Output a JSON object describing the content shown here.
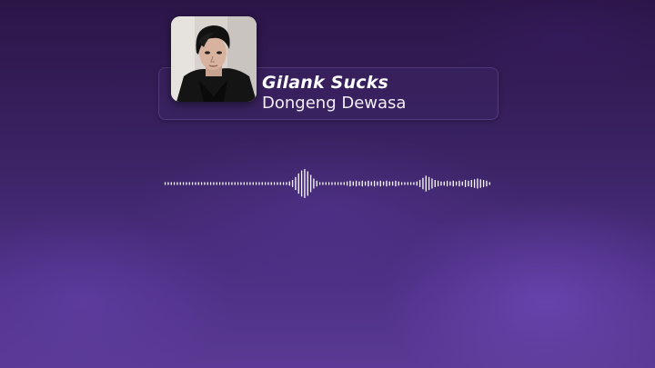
{
  "track": {
    "title": "Gilank Sucks",
    "artist": "Dongeng Dewasa",
    "cover_art": "artist-portrait-photo"
  },
  "visualizer": {
    "color": "#ffffff",
    "levels": [
      0.1,
      0.1,
      0.1,
      0.1,
      0.1,
      0.1,
      0.1,
      0.1,
      0.1,
      0.1,
      0.1,
      0.1,
      0.1,
      0.1,
      0.1,
      0.1,
      0.1,
      0.1,
      0.1,
      0.1,
      0.1,
      0.1,
      0.1,
      0.1,
      0.1,
      0.1,
      0.1,
      0.1,
      0.1,
      0.1,
      0.1,
      0.1,
      0.1,
      0.1,
      0.1,
      0.1,
      0.1,
      0.1,
      0.1,
      0.1,
      0.1,
      0.15,
      0.25,
      0.45,
      0.7,
      0.9,
      1.0,
      0.85,
      0.6,
      0.35,
      0.2,
      0.1,
      0.1,
      0.1,
      0.1,
      0.1,
      0.1,
      0.1,
      0.1,
      0.1,
      0.15,
      0.2,
      0.15,
      0.2,
      0.15,
      0.2,
      0.15,
      0.2,
      0.15,
      0.2,
      0.15,
      0.2,
      0.15,
      0.2,
      0.15,
      0.15,
      0.2,
      0.15,
      0.1,
      0.1,
      0.1,
      0.1,
      0.1,
      0.15,
      0.25,
      0.4,
      0.55,
      0.45,
      0.35,
      0.25,
      0.2,
      0.15,
      0.15,
      0.2,
      0.15,
      0.2,
      0.15,
      0.2,
      0.15,
      0.25,
      0.2,
      0.25,
      0.3,
      0.35,
      0.3,
      0.25,
      0.2,
      0.1
    ]
  },
  "colors": {
    "background_top": "#2b1547",
    "background_bottom": "#5a3a94",
    "text": "#ffffff"
  }
}
